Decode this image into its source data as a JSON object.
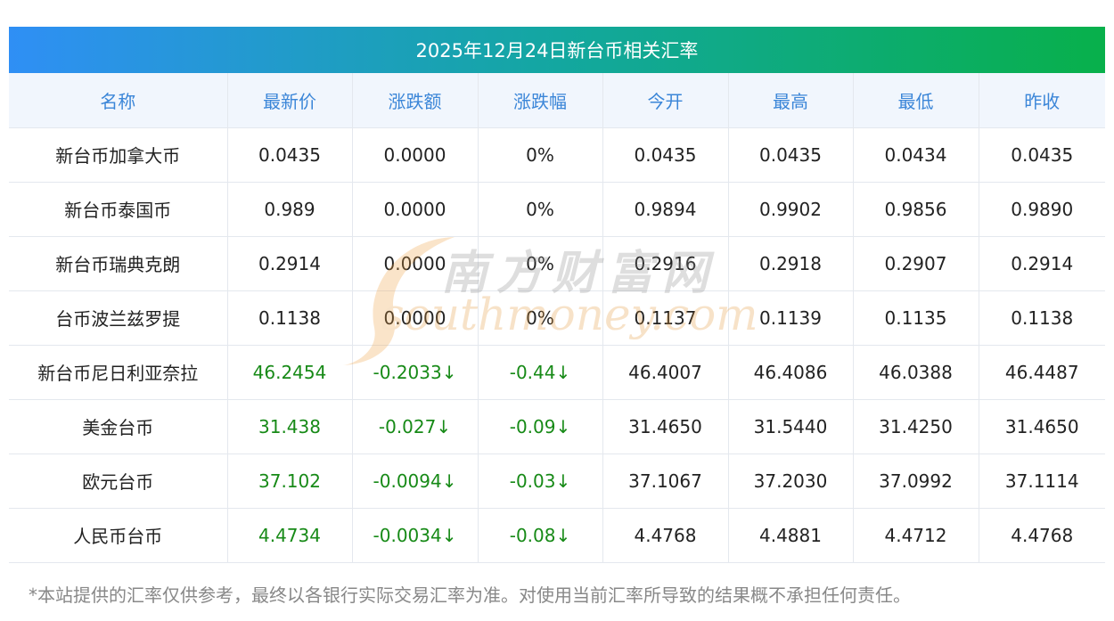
{
  "title": "2025年12月24日新台币相关汇率",
  "headers": [
    "名称",
    "最新价",
    "涨跌额",
    "涨跌幅",
    "今开",
    "最高",
    "最低",
    "昨收"
  ],
  "rows": [
    {
      "name": "新台币加拿大币",
      "latest": "0.0435",
      "change": "0.0000",
      "pct": "0%",
      "open": "0.0435",
      "high": "0.0435",
      "low": "0.0434",
      "prev": "0.0435",
      "down": false
    },
    {
      "name": "新台币泰国币",
      "latest": "0.989",
      "change": "0.0000",
      "pct": "0%",
      "open": "0.9894",
      "high": "0.9902",
      "low": "0.9856",
      "prev": "0.9890",
      "down": false
    },
    {
      "name": "新台币瑞典克朗",
      "latest": "0.2914",
      "change": "0.0000",
      "pct": "0%",
      "open": "0.2916",
      "high": "0.2918",
      "low": "0.2907",
      "prev": "0.2914",
      "down": false
    },
    {
      "name": "台币波兰兹罗提",
      "latest": "0.1138",
      "change": "0.0000",
      "pct": "0%",
      "open": "0.1137",
      "high": "0.1139",
      "low": "0.1135",
      "prev": "0.1138",
      "down": false
    },
    {
      "name": "新台币尼日利亚奈拉",
      "latest": "46.2454",
      "change": "-0.2033↓",
      "pct": "-0.44↓",
      "open": "46.4007",
      "high": "46.4086",
      "low": "46.0388",
      "prev": "46.4487",
      "down": true
    },
    {
      "name": "美金台币",
      "latest": "31.438",
      "change": "-0.027↓",
      "pct": "-0.09↓",
      "open": "31.4650",
      "high": "31.5440",
      "low": "31.4250",
      "prev": "31.4650",
      "down": true
    },
    {
      "name": "欧元台币",
      "latest": "37.102",
      "change": "-0.0094↓",
      "pct": "-0.03↓",
      "open": "37.1067",
      "high": "37.2030",
      "low": "37.0992",
      "prev": "37.1114",
      "down": true
    },
    {
      "name": "人民币台币",
      "latest": "4.4734",
      "change": "-0.0034↓",
      "pct": "-0.08↓",
      "open": "4.4768",
      "high": "4.4881",
      "low": "4.4712",
      "prev": "4.4768",
      "down": true
    }
  ],
  "watermark": {
    "cn": "南方财富网",
    "en": "southmoney.com"
  },
  "note": "*本站提供的汇率仅供参考，最终以各银行实际交易汇率为准。对使用当前汇率所导致的结果概不承担任何责任。",
  "colors": {
    "header_text": "#3b86d8",
    "header_bg": "#f1f6fd",
    "down": "#178a17",
    "gradient_start": "#2f8ff5",
    "gradient_end": "#08b04b"
  }
}
